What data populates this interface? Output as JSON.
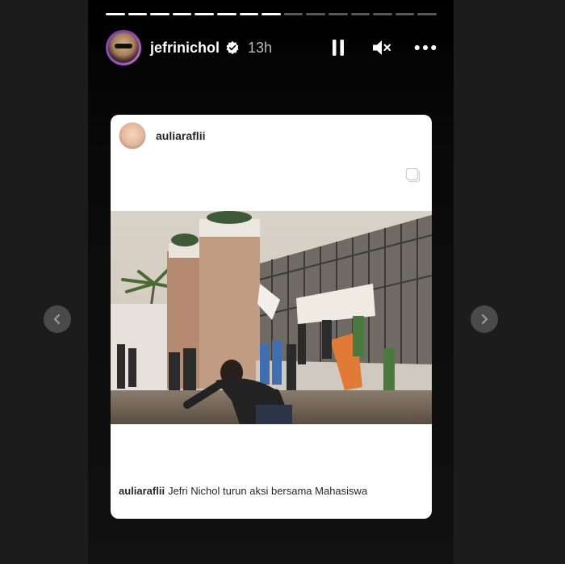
{
  "story": {
    "progress": {
      "total_segments": 15,
      "completed_segments": 8
    },
    "author": {
      "username": "jefrinichol",
      "verified": true,
      "time_ago": "13h"
    },
    "controls": {
      "pause_icon": "pause-icon",
      "mute_icon": "muted-speaker-icon",
      "more_icon": "more-horizontal-icon"
    }
  },
  "shared_post": {
    "username": "auliaraflii",
    "multi_photo_icon": "square-stack-icon",
    "photo_alt": "Protest scene with students and graffiti-covered wall",
    "caption_user": "auliaraflii",
    "caption_text": "Jefri Nichol turun aksi bersama Mahasiswa"
  },
  "navigation": {
    "prev_icon": "chevron-left-icon",
    "next_icon": "chevron-right-icon"
  }
}
